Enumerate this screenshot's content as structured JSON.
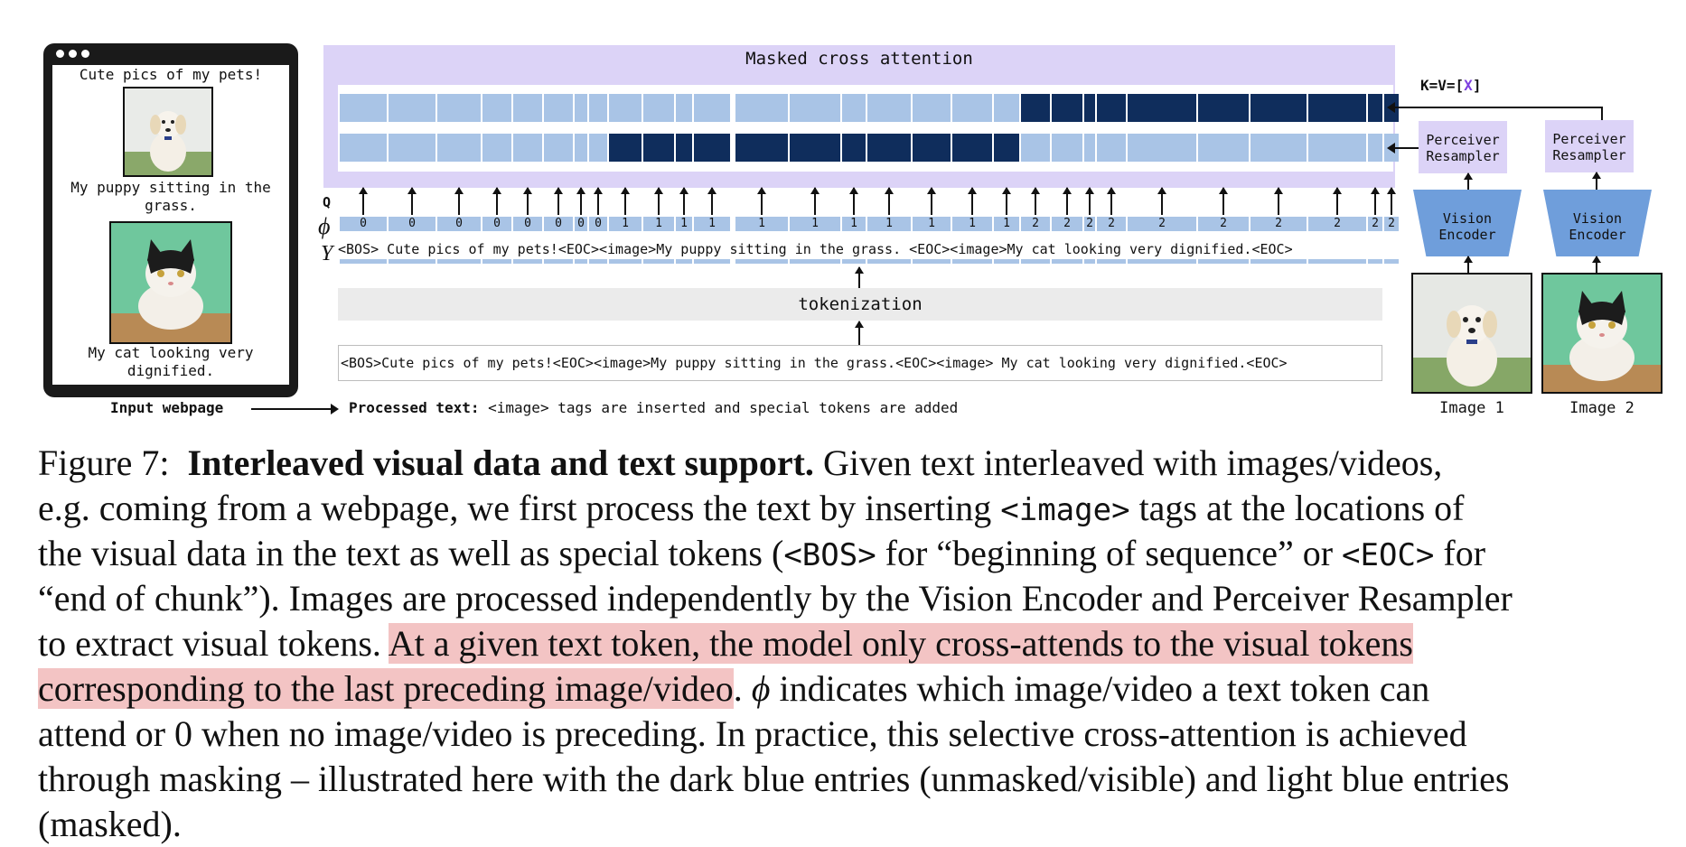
{
  "webpage": {
    "title_text": "Cute pics of my pets!",
    "puppy_caption": "My puppy sitting in the grass.",
    "cat_caption": "My cat looking very dignified.",
    "label": "Input webpage"
  },
  "attention": {
    "title": "Masked cross attention",
    "kv_label_prefix": "K=V=[",
    "kv_label_x": "X",
    "kv_label_suffix": "]",
    "colors": {
      "light": "#a9c4e6",
      "dark": "#0f2d5c",
      "panel": "#dcd3f7"
    }
  },
  "axis_labels": {
    "q": "Q",
    "phi": "ϕ",
    "y": "Y"
  },
  "phi_values": [
    "0",
    "0",
    "0",
    "0",
    "0",
    "0",
    "0",
    "0",
    "1",
    "1",
    "1",
    "1",
    "1",
    "1",
    "1",
    "1",
    "1",
    "1",
    "1",
    "2",
    "2",
    "2",
    "2",
    "2",
    "2",
    "2",
    "2",
    "2",
    "2"
  ],
  "token_text": "<BOS> Cute pics of my pets!<EOC><image>My puppy sitting in the grass. <EOC><image>My cat looking very dignified.<EOC>",
  "tokenization_label": "tokenization",
  "processed_input": "<BOS>Cute pics of my pets!<EOC><image>My puppy sitting in the grass.<EOC><image> My cat looking very dignified.<EOC>",
  "processed_label_bold": "Processed text:",
  "processed_label_rest": "<image> tags are inserted and special tokens are added",
  "encoders": [
    {
      "resampler": "Perceiver\nResampler",
      "encoder": "Vision\nEncoder",
      "image_label": "Image 1"
    },
    {
      "resampler": "Perceiver\nResampler",
      "encoder": "Vision\nEncoder",
      "image_label": "Image 2"
    }
  ],
  "caption": {
    "fig": "Figure 7:",
    "bold": "Interleaved visual data and text support.",
    "l1_rest": "Given text interleaved with images/videos,",
    "l2a": "e.g. coming from a webpage, we first process the text by inserting",
    "l2code": "<image>",
    "l2b": "tags at the locations of",
    "l3a": "the visual data in the text as well as special tokens (",
    "l3code1": "<BOS>",
    "l3b": "for “beginning of sequence” or",
    "l3code2": "<EOC>",
    "l3c": "for",
    "l4": "“end of chunk”). Images are processed independently by the Vision Encoder and Perceiver Resampler",
    "l5a": "to extract visual tokens.",
    "l5hl": "At a given text token, the model only cross-attends to the visual tokens",
    "l6hl": "corresponding to the last preceding image/video",
    "l6b": ".",
    "l6phi": "ϕ",
    "l6c": "indicates which image/video a text token can",
    "l7": "attend or 0 when no image/video is preceding. In practice, this selective cross-attention is achieved",
    "l8": "through masking – illustrated here with the dark blue entries (unmasked/visible) and light blue entries",
    "l9": "(masked)."
  }
}
